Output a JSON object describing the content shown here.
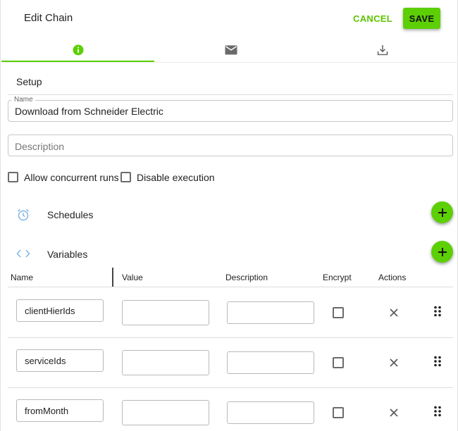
{
  "header": {
    "title": "Edit Chain",
    "cancel_label": "CANCEL",
    "save_label": "SAVE"
  },
  "tabs": [
    {
      "icon": "info-icon",
      "active": true
    },
    {
      "icon": "mail-icon",
      "active": false
    },
    {
      "icon": "download-icon",
      "active": false
    }
  ],
  "setup": {
    "section_title": "Setup",
    "name_label": "Name",
    "name_value": "Download from Schneider Electric",
    "description_placeholder": "Description",
    "allow_concurrent_label": "Allow concurrent runs",
    "allow_concurrent_checked": false,
    "disable_execution_label": "Disable execution",
    "disable_execution_checked": false
  },
  "schedules": {
    "label": "Schedules",
    "icon": "alarm-clock-icon"
  },
  "variables": {
    "label": "Variables",
    "icon": "code-icon",
    "columns": [
      "Name",
      "Value",
      "Description",
      "Encrypt",
      "Actions"
    ],
    "rows": [
      {
        "name": "clientHierIds",
        "value": "",
        "description": "",
        "encrypt": false
      },
      {
        "name": "serviceIds",
        "value": "",
        "description": "",
        "encrypt": false
      },
      {
        "name": "fromMonth",
        "value": "",
        "description": "",
        "encrypt": false
      }
    ]
  },
  "colors": {
    "accent": "#5ccf05",
    "border": "#c8c8c8",
    "text": "#222222"
  }
}
